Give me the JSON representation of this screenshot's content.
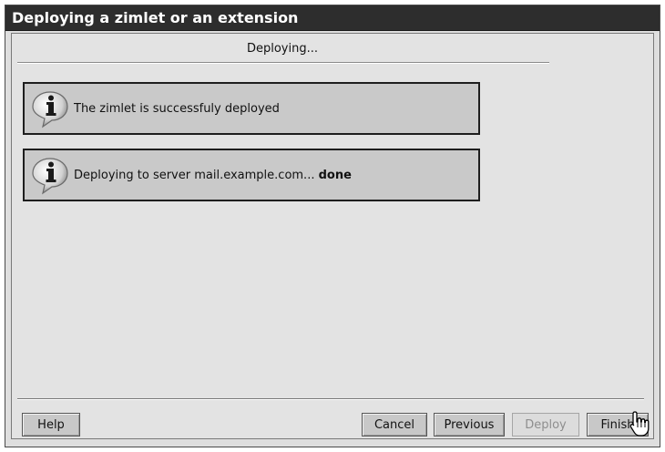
{
  "window": {
    "title": "Deploying a zimlet or an extension"
  },
  "wizard": {
    "step_label": "Deploying..."
  },
  "messages": [
    {
      "icon": "info-icon",
      "text": "The zimlet is successfuly deployed",
      "bold": ""
    },
    {
      "icon": "info-icon",
      "text": "Deploying to server mail.example.com... ",
      "bold": "done"
    }
  ],
  "buttons": {
    "help": "Help",
    "cancel": "Cancel",
    "previous": "Previous",
    "deploy": "Deploy",
    "finish": "Finish"
  },
  "cursor": {
    "icon": "hand-pointer-icon"
  }
}
